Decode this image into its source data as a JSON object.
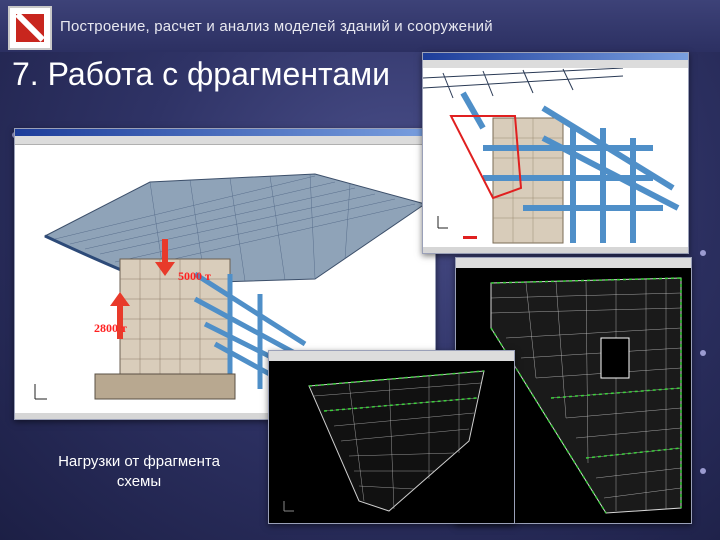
{
  "header": {
    "title": "Построение, расчет и анализ моделей зданий и сооружений"
  },
  "slide": {
    "title": "7. Работа с фрагментами",
    "caption_line1": "Нагрузки от фрагмента",
    "caption_line2": "схемы"
  },
  "loads": {
    "load_top": "5000 т",
    "load_side": "2800 т"
  },
  "colors": {
    "background": "#2f3366",
    "accent_red": "#c8261e",
    "structure_blue": "#4f8fc8",
    "mesh_green": "#3cd23c"
  }
}
